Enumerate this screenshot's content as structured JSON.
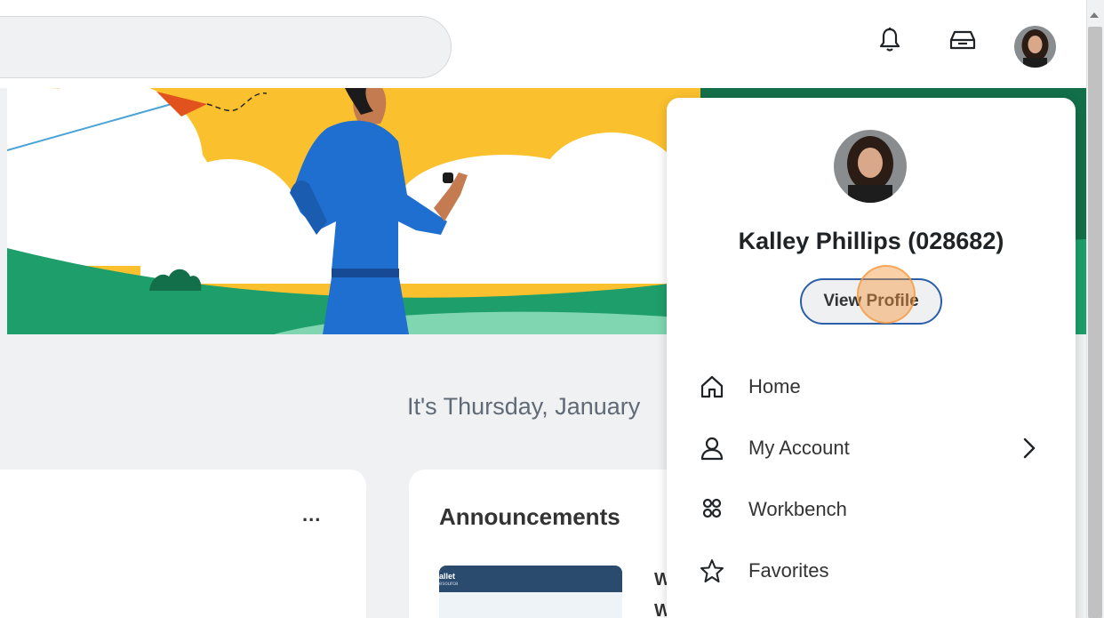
{
  "header": {
    "search_placeholder": "",
    "notifications_icon": "bell-icon",
    "inbox_icon": "inbox-icon",
    "avatar_icon": "user-avatar"
  },
  "greeting": "It's Thursday, January",
  "cards": {
    "first_more": "...",
    "announcements_title": "Announcements",
    "announcement_thumb_brand": "allet",
    "announcement_thumb_sub": "esource",
    "announcement_text_line1": "W",
    "announcement_text_line2": "W"
  },
  "profile_popup": {
    "name": "Kalley Phillips (028682)",
    "view_profile_label": "View Profile",
    "menu": [
      {
        "label": "Home",
        "icon": "home-icon"
      },
      {
        "label": "My Account",
        "icon": "user-icon",
        "has_submenu": true
      },
      {
        "label": "Workbench",
        "icon": "people-group-icon"
      },
      {
        "label": "Favorites",
        "icon": "star-icon"
      }
    ]
  },
  "colors": {
    "accent_blue": "#2d5ea8",
    "banner_yellow": "#fbc02d",
    "banner_green": "#1e9e6a",
    "figure_blue": "#1f6fd0"
  }
}
